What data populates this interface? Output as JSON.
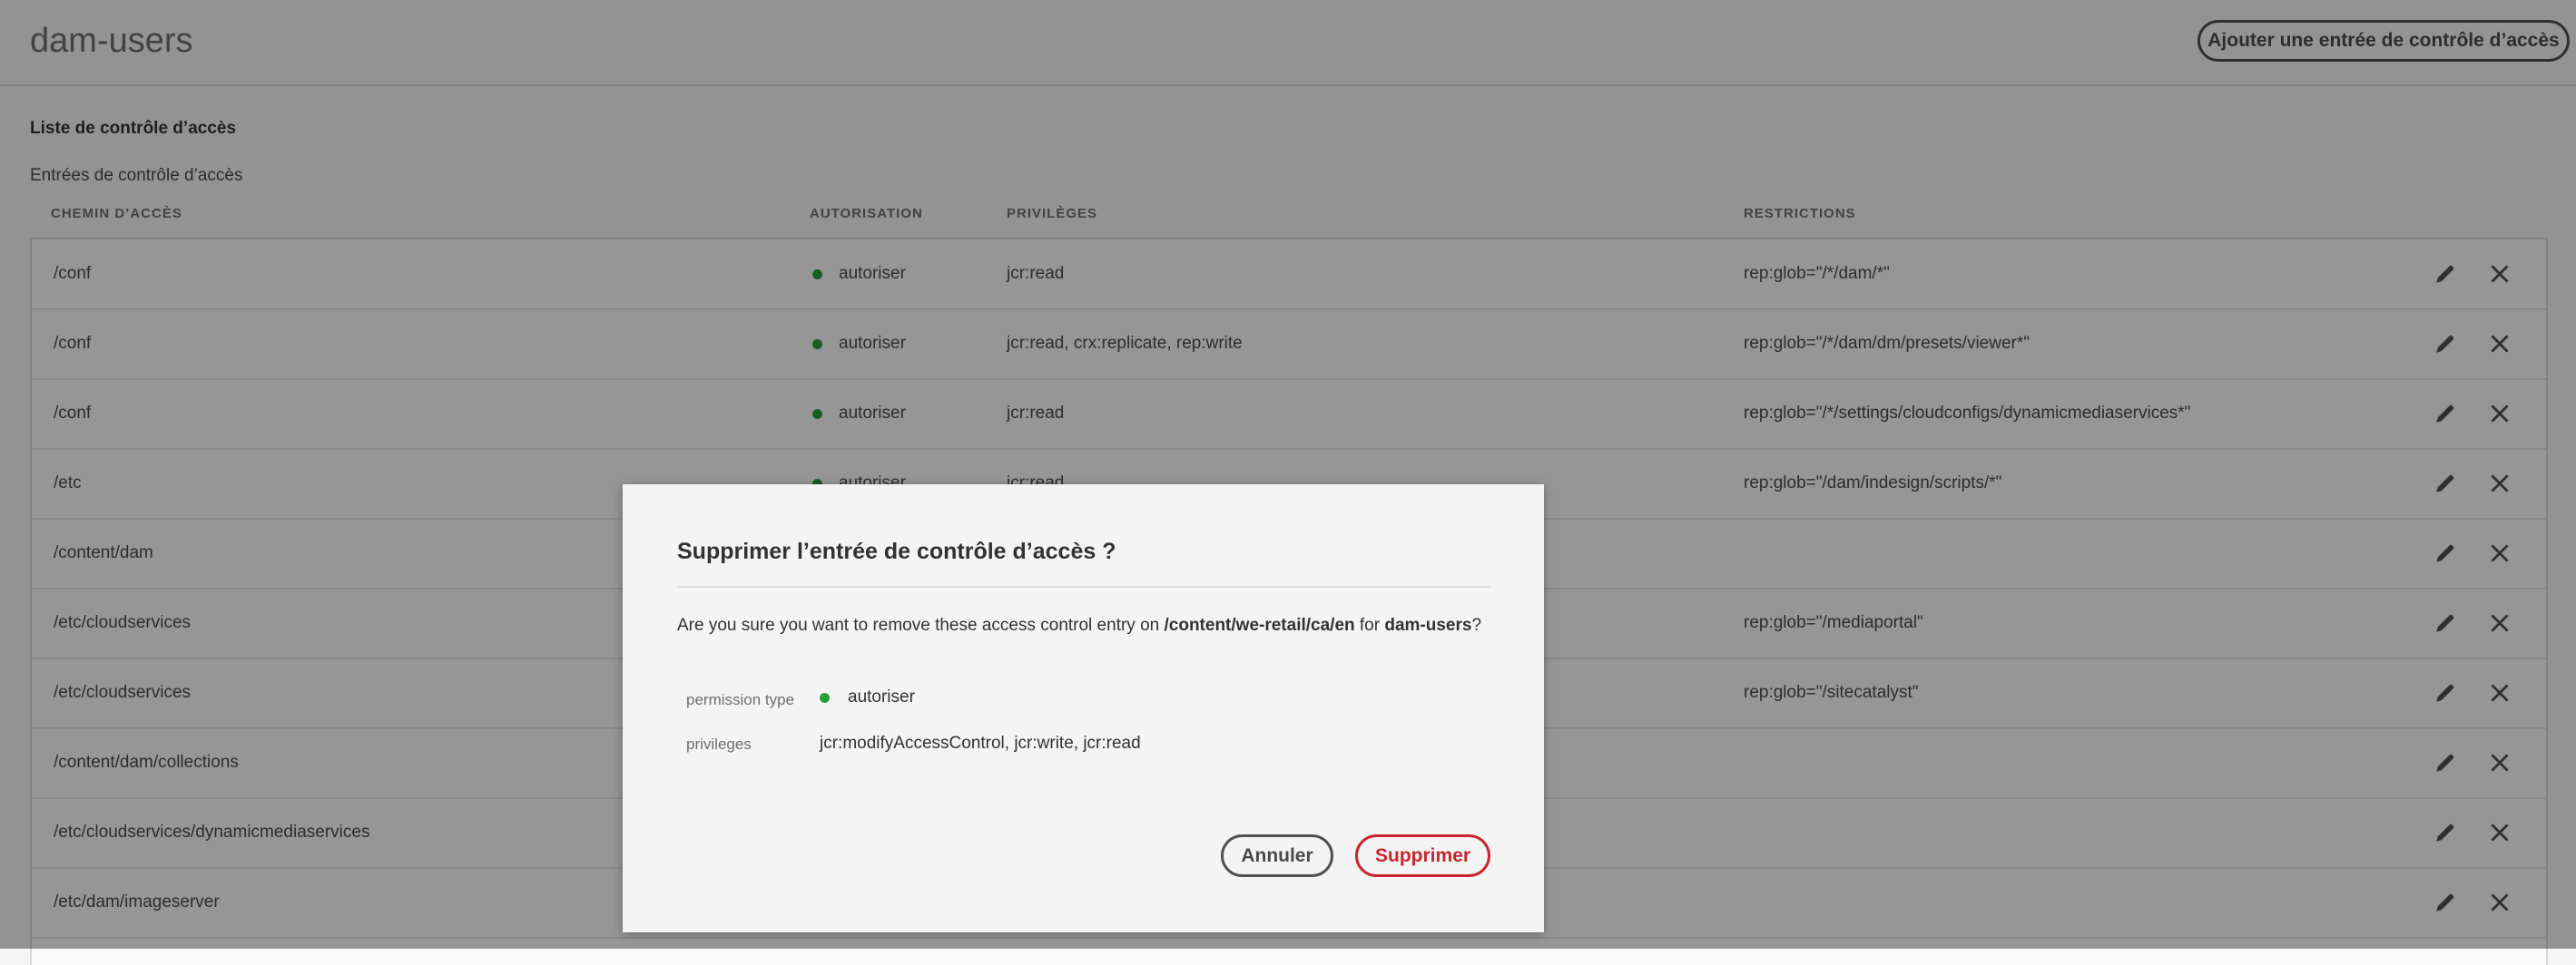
{
  "header": {
    "title": "dam-users",
    "add_button_label": "Ajouter une entrée de contrôle d’accès"
  },
  "section": {
    "acl_heading": "Liste de contrôle d’accès",
    "ace_heading": "Entrées de contrôle d’accès"
  },
  "columns": {
    "path": "CHEMIN D’ACCÈS",
    "authorization": "AUTORISATION",
    "privileges": "PRIVILÈGES",
    "restrictions": "RESTRICTIONS"
  },
  "rows": [
    {
      "path": "/conf",
      "authorization": "autoriser",
      "privileges": "jcr:read",
      "restrictions": "rep:glob=\"/*/dam/*\""
    },
    {
      "path": "/conf",
      "authorization": "autoriser",
      "privileges": "jcr:read, crx:replicate, rep:write",
      "restrictions": "rep:glob=\"/*/dam/dm/presets/viewer*\""
    },
    {
      "path": "/conf",
      "authorization": "autoriser",
      "privileges": "jcr:read",
      "restrictions": "rep:glob=\"/*/settings/cloudconfigs/dynamicmediaservices*\""
    },
    {
      "path": "/etc",
      "authorization": "autoriser",
      "privileges": "jcr:read",
      "restrictions": "rep:glob=\"/dam/indesign/scripts/*\""
    },
    {
      "path": "/content/dam",
      "authorization": "",
      "privileges": "",
      "restrictions": ""
    },
    {
      "path": "/etc/cloudservices",
      "authorization": "",
      "privileges": "",
      "restrictions": "rep:glob=\"/mediaportal\""
    },
    {
      "path": "/etc/cloudservices",
      "authorization": "",
      "privileges": "",
      "restrictions": "rep:glob=\"/sitecatalyst\""
    },
    {
      "path": "/content/dam/collections",
      "authorization": "",
      "privileges": "",
      "restrictions": ""
    },
    {
      "path": "/etc/cloudservices/dynamicmediaservices",
      "authorization": "",
      "privileges": "",
      "restrictions": ""
    },
    {
      "path": "/etc/dam/imageserver",
      "authorization": "",
      "privileges": "",
      "restrictions": ""
    }
  ],
  "icons": {
    "edit": "pencil-icon",
    "delete": "close-icon"
  },
  "dialog": {
    "title": "Supprimer l’entrée de contrôle d’accès ?",
    "message_prefix": "Are you sure you want to remove these access control entry on ",
    "message_path": "/content/we-retail/ca/en",
    "message_mid": " for ",
    "message_user": "dam-users",
    "message_suffix": "?",
    "permission_type_label": "permission type",
    "permission_type_value": "autoriser",
    "privileges_label": "privileges",
    "privileges_value": "jcr:modifyAccessControl, jcr:write, jcr:read",
    "cancel_label": "Annuler",
    "delete_label": "Supprimer"
  },
  "colors": {
    "allow_dot": "#2d9d3a",
    "delete_accent": "#c9252d"
  }
}
